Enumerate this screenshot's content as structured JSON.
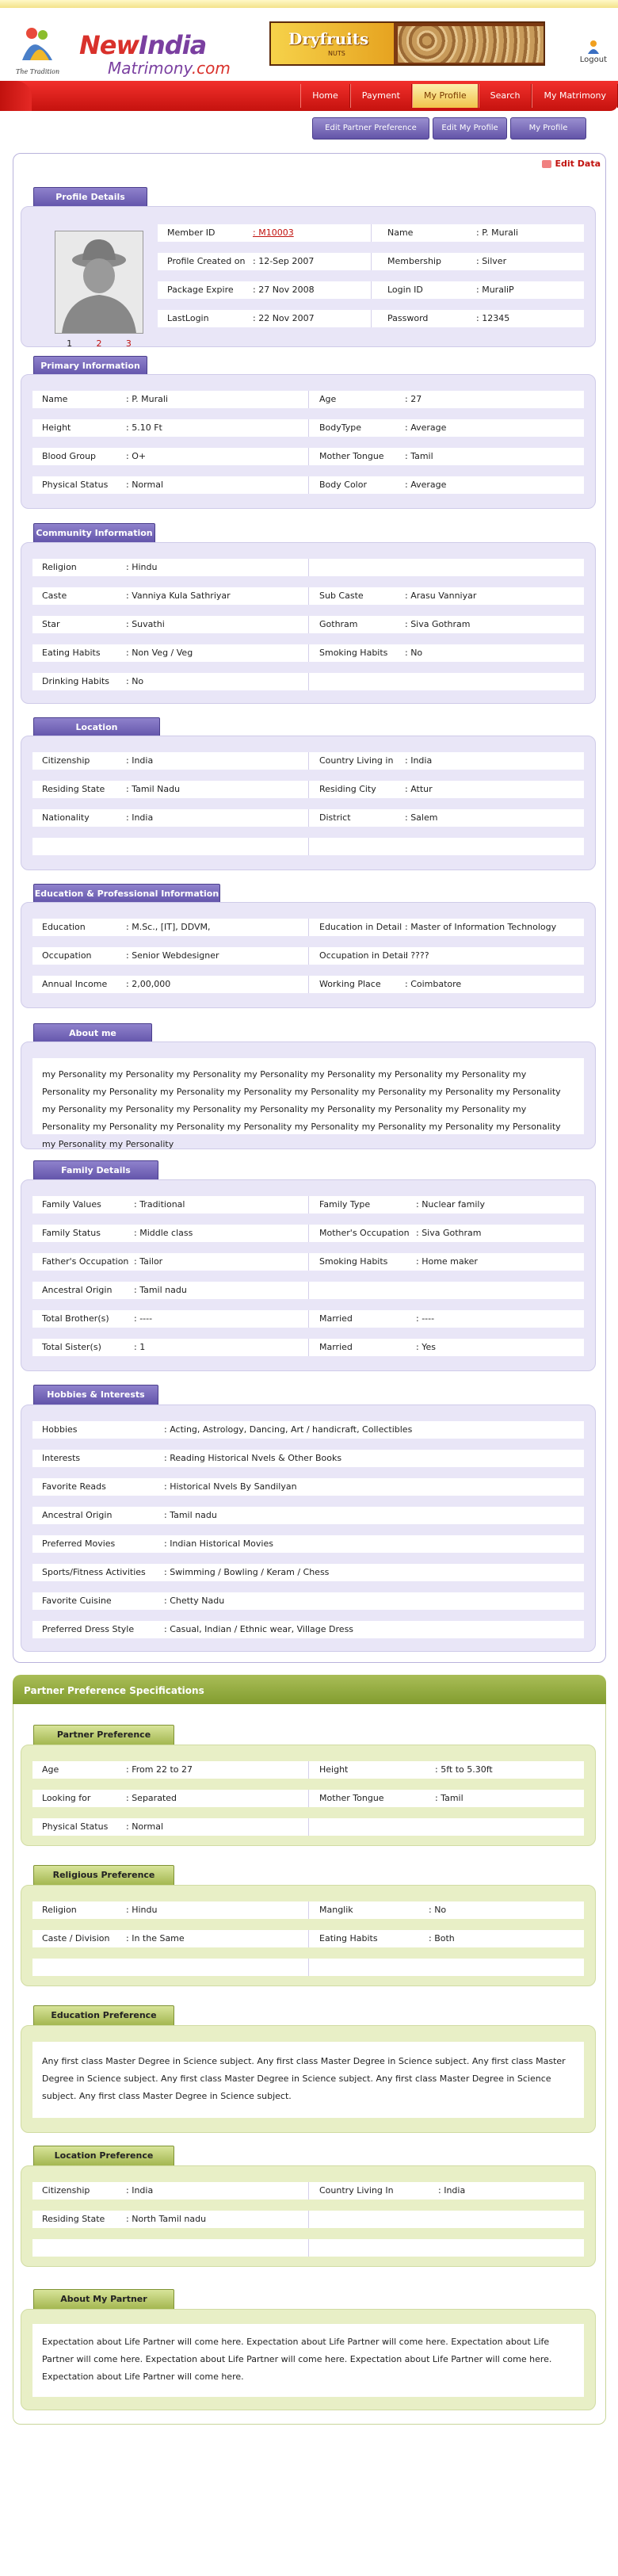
{
  "header": {
    "logo_new": "New",
    "logo_india": "India",
    "logo_matrimony": "Matrimony",
    "logo_com": ".com",
    "logo_tagline": "The Tradition",
    "ad_title": "Dryfruits",
    "ad_sub": "NUTS",
    "logout_label": "Logout"
  },
  "nav": [
    "Home",
    "Payment",
    "My Profile",
    "Search",
    "My Matrimony"
  ],
  "nav_active": "My Profile",
  "subtabs": [
    "Edit Partner Preference",
    "Edit My Profile",
    "My Profile"
  ],
  "edit_data": "Edit Data",
  "profile_details": {
    "title": "Profile Details",
    "photo_pages": [
      "1",
      "2",
      "3"
    ],
    "rows": [
      [
        "Member ID",
        ": M10003",
        "Name",
        ": P. Murali"
      ],
      [
        "Profile Created on",
        ": 12-Sep 2007",
        "Membership",
        ": Silver"
      ],
      [
        "Package Expire",
        ": 27 Nov 2008",
        "Login ID",
        ": MuraliP"
      ],
      [
        "LastLogin",
        ": 22 Nov 2007",
        "Password",
        ": 12345"
      ]
    ]
  },
  "primary": {
    "title": "Primary Information",
    "rows": [
      [
        "Name",
        ": P. Murali",
        "Age",
        ": 27"
      ],
      [
        "Height",
        ": 5.10 Ft",
        "BodyType",
        ": Average"
      ],
      [
        "Blood Group",
        ": O+",
        "Mother Tongue",
        ": Tamil"
      ],
      [
        "Physical Status",
        ": Normal",
        "Body Color",
        ": Average"
      ]
    ]
  },
  "community": {
    "title": "Community Information",
    "rows": [
      [
        "Religion",
        ": Hindu",
        "",
        ""
      ],
      [
        "Caste",
        ": Vanniya Kula Sathriyar",
        "Sub Caste",
        ": Arasu Vanniyar"
      ],
      [
        "Star",
        ": Suvathi",
        "Gothram",
        ": Siva Gothram"
      ],
      [
        "Eating Habits",
        ": Non Veg / Veg",
        "Smoking Habits",
        ": No"
      ],
      [
        "Drinking Habits",
        ": No",
        "",
        ""
      ]
    ]
  },
  "location": {
    "title": "Location",
    "rows": [
      [
        "Citizenship",
        ": India",
        "Country Living in",
        ": India"
      ],
      [
        "Residing State",
        ": Tamil Nadu",
        "Residing City",
        ": Attur"
      ],
      [
        "Nationality",
        ": India",
        "District",
        ": Salem"
      ],
      [
        "",
        "",
        "",
        ""
      ]
    ]
  },
  "education": {
    "title": "Education & Professional Information",
    "rows": [
      [
        "Education",
        ": M.Sc., [IT], DDVM,",
        "Education in Detail",
        ": Master of Information Technology"
      ],
      [
        "Occupation",
        ": Senior Webdesigner",
        "Occupation in Detail",
        ": ????"
      ],
      [
        "Annual Income",
        ": 2,00,000",
        "Working Place",
        ": Coimbatore"
      ]
    ]
  },
  "about": {
    "title": "About me",
    "text": "my Personality my Personality my Personality my Personality my Personality my Personality my Personality my Personality my Personality my Personality my Personality my Personality my Personality my Personality my Personality my Personality my Personality my Personality my Personality my Personality my Personality my Personality my Personality my Personality my Personality my Personality my Personality my Personality my Personality my Personality my Personality my Personality"
  },
  "family": {
    "title": "Family Details",
    "rows": [
      [
        "Family Values",
        ": Traditional",
        "Family Type",
        ": Nuclear family"
      ],
      [
        "Family Status",
        ": Middle class",
        "Mother's Occupation",
        ": Siva Gothram"
      ],
      [
        "Father's Occupation",
        ": Tailor",
        "Smoking Habits",
        ": Home maker"
      ],
      [
        "Ancestral Origin",
        ": Tamil nadu",
        "",
        ""
      ],
      [
        "Total Brother(s)",
        ": ----",
        "Married",
        ": ----"
      ],
      [
        "Total Sister(s)",
        ": 1",
        "Married",
        ": Yes"
      ]
    ]
  },
  "hobbies": {
    "title": "Hobbies & Interests",
    "rows": [
      [
        "Hobbies",
        ": Acting, Astrology, Dancing, Art / handicraft, Collectibles"
      ],
      [
        "Interests",
        ": Reading Historical Nvels & Other Books"
      ],
      [
        "Favorite Reads",
        ": Historical Nvels By Sandilyan"
      ],
      [
        "Ancestral Origin",
        ": Tamil nadu"
      ],
      [
        "Preferred Movies",
        ": Indian Historical Movies"
      ],
      [
        "Sports/Fitness Activities",
        ": Swimming / Bowling / Keram / Chess"
      ],
      [
        "Favorite Cuisine",
        ": Chetty Nadu"
      ],
      [
        "Preferred Dress Style",
        ": Casual, Indian / Ethnic wear, Village Dress"
      ]
    ]
  },
  "partner": {
    "header": "Partner Preference Specifications",
    "pref": {
      "title": "Partner Preference",
      "rows": [
        [
          "Age",
          ": From 22 to 27",
          "Height",
          ": 5ft to 5.30ft"
        ],
        [
          "Looking for",
          ": Separated",
          "Mother Tongue",
          ": Tamil"
        ],
        [
          "Physical Status",
          ": Normal",
          "",
          ""
        ]
      ]
    },
    "religious": {
      "title": "Religious Preference",
      "rows": [
        [
          "Religion",
          ": Hindu",
          "Manglik",
          ": No"
        ],
        [
          "Caste / Division",
          ": In the Same",
          "Eating Habits",
          ": Both"
        ],
        [
          "",
          "",
          "",
          ""
        ]
      ]
    },
    "education": {
      "title": "Education Preference",
      "text": "Any first class Master Degree in Science subject. Any first class Master Degree in Science subject. Any first class Master Degree in Science subject. Any first class Master Degree in Science subject. Any first class Master Degree in Science subject. Any first class Master Degree in Science subject."
    },
    "location": {
      "title": "Location Preference",
      "rows": [
        [
          "Citizenship",
          ": India",
          "Country Living In",
          ": India"
        ],
        [
          "Residing State",
          ": North Tamil nadu",
          "",
          ""
        ],
        [
          "",
          "",
          "",
          ""
        ]
      ]
    },
    "about": {
      "title": "About My Partner",
      "text": "Expectation about Life Partner will come here. Expectation about Life Partner will come here. Expectation about Life Partner will come here. Expectation about Life Partner will come here. Expectation about Life Partner will come here. Expectation about Life Partner will come here."
    }
  }
}
